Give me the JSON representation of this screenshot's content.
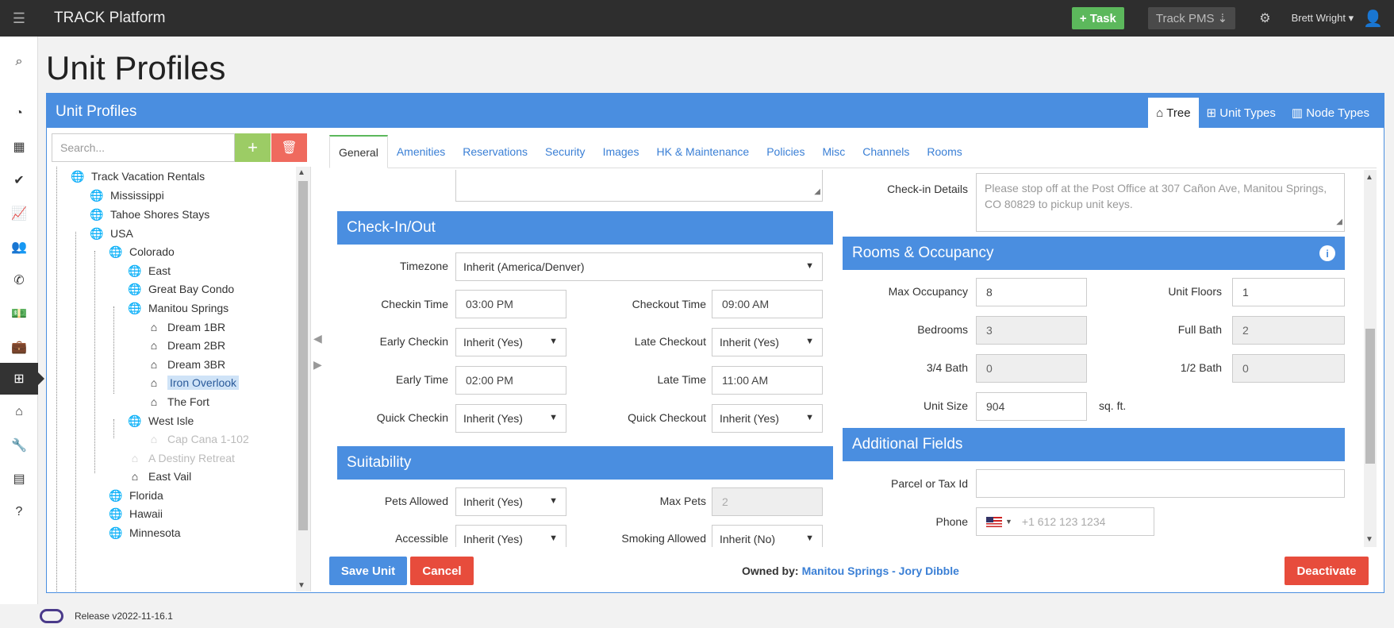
{
  "app": {
    "title": "TRACK Platform"
  },
  "topbar": {
    "task_label": "+ Task",
    "pms_label": "Track PMS ⇣",
    "user_name": "Brett Wright ▾"
  },
  "page": {
    "title": "Unit Profiles"
  },
  "panel": {
    "title": "Unit Profiles",
    "view_tabs": [
      "⌂ Tree",
      "⊞ Unit Types",
      "▥ Node Types"
    ]
  },
  "search": {
    "placeholder": "Search..."
  },
  "tree": [
    {
      "label": "Track Vacation Rentals",
      "icon": "globe-icon",
      "state": "normal"
    },
    {
      "label": "Mississippi",
      "icon": "globe-icon",
      "state": "normal"
    },
    {
      "label": "Tahoe Shores Stays",
      "icon": "globe-icon",
      "state": "normal"
    },
    {
      "label": "USA",
      "icon": "globe-icon",
      "state": "normal"
    },
    {
      "label": "Colorado",
      "icon": "globe-icon",
      "state": "normal"
    },
    {
      "label": "East",
      "icon": "globe-icon",
      "state": "normal"
    },
    {
      "label": "Great Bay Condo",
      "icon": "globe-icon",
      "state": "normal"
    },
    {
      "label": "Manitou Springs",
      "icon": "globe-icon",
      "state": "normal"
    },
    {
      "label": "Dream 1BR",
      "icon": "home-icon",
      "state": "normal"
    },
    {
      "label": "Dream 2BR",
      "icon": "home-icon",
      "state": "normal"
    },
    {
      "label": "Dream 3BR",
      "icon": "home-icon",
      "state": "normal"
    },
    {
      "label": "Iron Overlook",
      "icon": "home-icon",
      "state": "selected"
    },
    {
      "label": "The Fort",
      "icon": "home-icon",
      "state": "normal"
    },
    {
      "label": "West Isle",
      "icon": "globe-icon",
      "state": "normal"
    },
    {
      "label": "Cap Cana 1-102",
      "icon": "home-icon",
      "state": "disabled"
    },
    {
      "label": "A Destiny Retreat",
      "icon": "home-icon",
      "state": "disabled"
    },
    {
      "label": "East Vail",
      "icon": "home-icon",
      "state": "normal"
    },
    {
      "label": "Florida",
      "icon": "globe-icon",
      "state": "normal"
    },
    {
      "label": "Hawaii",
      "icon": "globe-icon",
      "state": "normal"
    },
    {
      "label": "Minnesota",
      "icon": "globe-icon",
      "state": "normal"
    }
  ],
  "tabs": [
    "General",
    "Amenities",
    "Reservations",
    "Security",
    "Images",
    "HK & Maintenance",
    "Policies",
    "Misc",
    "Channels",
    "Rooms"
  ],
  "checkin": {
    "section_title": "Check-In/Out",
    "timezone_label": "Timezone",
    "timezone_value": "Inherit (America/Denver)",
    "checkin_time_label": "Checkin Time",
    "checkin_time_value": "03:00 PM",
    "checkout_time_label": "Checkout Time",
    "checkout_time_value": "09:00 AM",
    "early_checkin_label": "Early Checkin",
    "early_checkin_value": "Inherit (Yes)",
    "late_checkout_label": "Late Checkout",
    "late_checkout_value": "Inherit (Yes)",
    "early_time_label": "Early Time",
    "early_time_value": "02:00 PM",
    "late_time_label": "Late Time",
    "late_time_value": "11:00 AM",
    "quick_checkin_label": "Quick Checkin",
    "quick_checkin_value": "Inherit (Yes)",
    "quick_checkout_label": "Quick Checkout",
    "quick_checkout_value": "Inherit (Yes)"
  },
  "suitability": {
    "section_title": "Suitability",
    "pets_allowed_label": "Pets Allowed",
    "pets_allowed_value": "Inherit (Yes)",
    "max_pets_label": "Max Pets",
    "max_pets_value": "2",
    "accessible_label": "Accessible",
    "accessible_value": "Inherit (Yes)",
    "smoking_label": "Smoking Allowed",
    "smoking_value": "Inherit (No)"
  },
  "checkin_details": {
    "label": "Check-in Details",
    "placeholder": "Please stop off at the Post Office at 307 Cañon Ave, Manitou Springs, CO 80829 to pickup unit keys."
  },
  "rooms": {
    "section_title": "Rooms & Occupancy",
    "max_occupancy_label": "Max Occupancy",
    "max_occupancy_value": "8",
    "unit_floors_label": "Unit Floors",
    "unit_floors_value": "1",
    "bedrooms_label": "Bedrooms",
    "bedrooms_value": "3",
    "full_bath_label": "Full Bath",
    "full_bath_value": "2",
    "three_quarter_bath_label": "3/4 Bath",
    "three_quarter_bath_value": "0",
    "half_bath_label": "1/2 Bath",
    "half_bath_value": "0",
    "unit_size_label": "Unit Size",
    "unit_size_value": "904",
    "unit_size_unit": "sq. ft."
  },
  "additional": {
    "section_title": "Additional Fields",
    "parcel_label": "Parcel or Tax Id",
    "parcel_value": "",
    "phone_label": "Phone",
    "phone_placeholder": "+1 612 123 1234"
  },
  "footer": {
    "save_label": "Save Unit",
    "cancel_label": "Cancel",
    "owned_prefix": "Owned by:",
    "owned_link": "Manitou Springs - Jory Dibble",
    "deactivate_label": "Deactivate"
  },
  "release": {
    "text": "Release v2022-11-16.1"
  },
  "colors": {
    "brand_blue": "#4a8ee0",
    "green": "#5cb85c",
    "red": "#e74c3c",
    "topbar": "#2e2e2e"
  }
}
